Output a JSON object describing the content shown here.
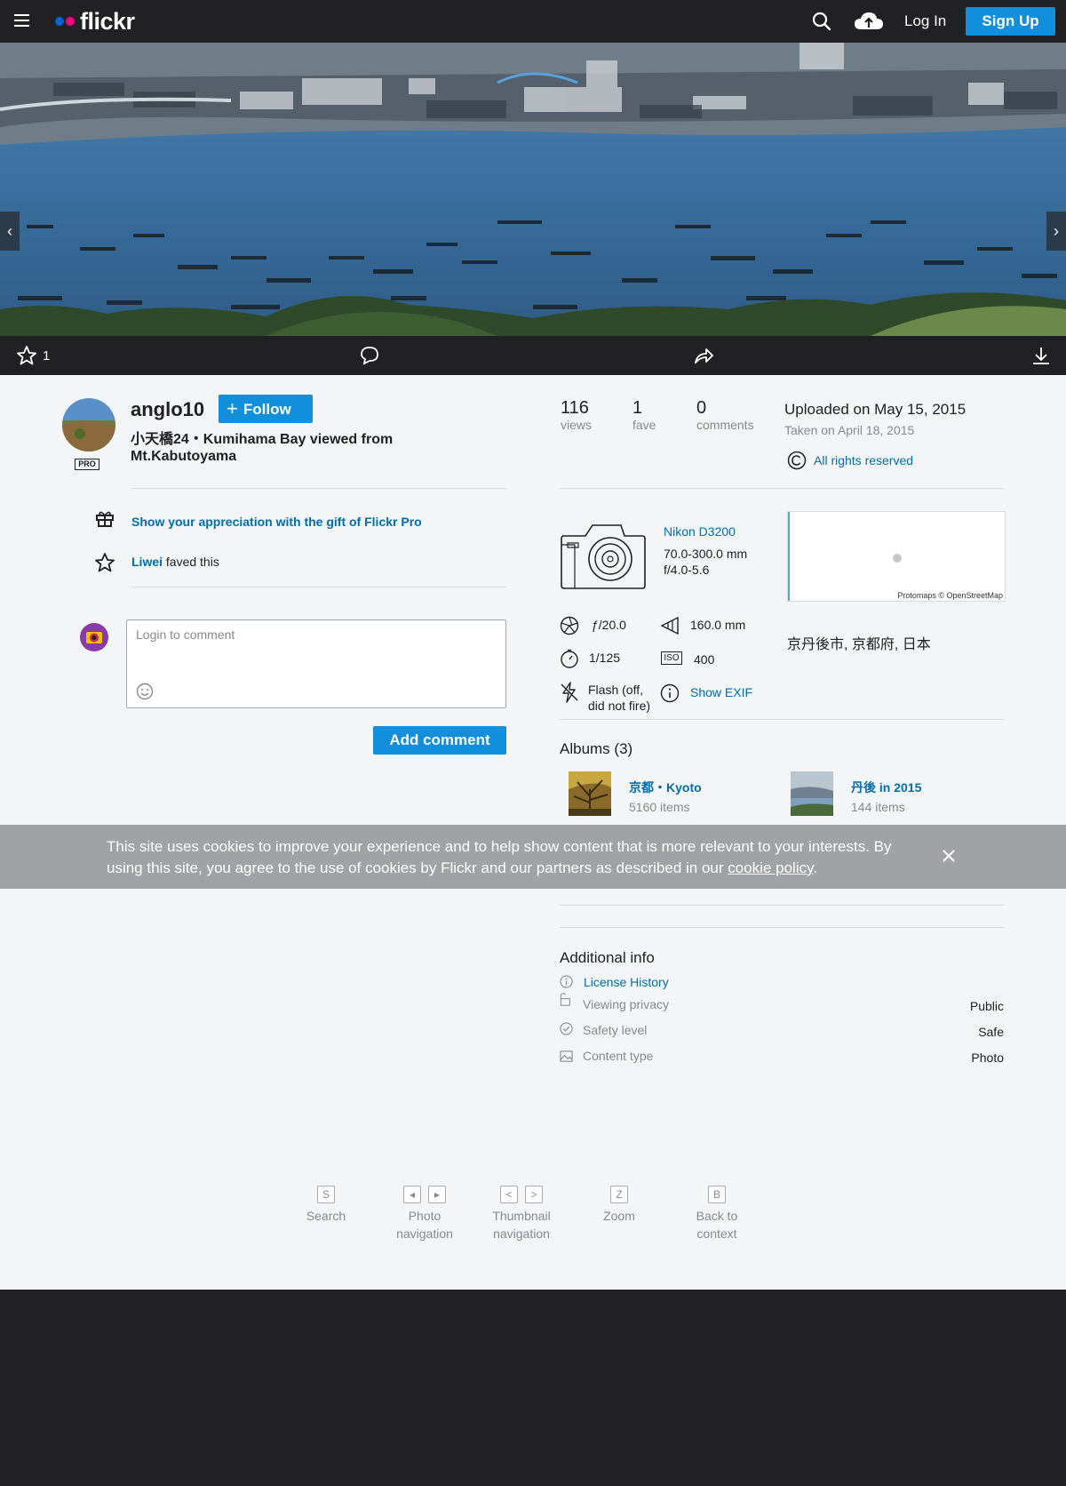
{
  "header": {
    "logo": "flickr",
    "login": "Log In",
    "signup": "Sign Up",
    "colors": {
      "blue_dot": "#0063dc",
      "pink_dot": "#ff0084",
      "accent": "#128fdc"
    }
  },
  "photo_nav": {
    "prev": "‹",
    "next": "›"
  },
  "action_bar": {
    "fave_count": "1"
  },
  "owner": {
    "username": "anglo10",
    "badge": "PRO",
    "follow_label": "Follow",
    "photo_title": "小天橋24・Kumihama Bay viewed from Mt.Kabutoyama"
  },
  "appreciation": {
    "gift_text": "Show your appreciation with the gift of Flickr Pro"
  },
  "faves": {
    "user": "Liwei",
    "text": "faved this"
  },
  "comment": {
    "placeholder": "Login to comment",
    "button": "Add comment"
  },
  "stats": {
    "views": "116",
    "views_label": "views",
    "faves": "1",
    "faves_label": "fave",
    "comments": "0",
    "comments_label": "comments"
  },
  "dates": {
    "uploaded": "Uploaded on May 15, 2015",
    "taken": "Taken on April 18, 2015",
    "rights": "All rights reserved"
  },
  "camera": {
    "model": "Nikon D3200",
    "lens": "70.0-300.0 mm",
    "aperture_range": "f/4.0-5.6"
  },
  "map": {
    "attribution": "Protomaps © OpenStreetMap"
  },
  "location": "京丹後市, 京都府, 日本",
  "exif": {
    "aperture": "ƒ/20.0",
    "focal_length": "160.0 mm",
    "shutter": "1/125",
    "iso": "400",
    "iso_label": "ISO",
    "flash_line1": "Flash (off,",
    "flash_line2": "did not fire)",
    "show_exif": "Show EXIF"
  },
  "albums": {
    "title": "Albums (3)",
    "items": [
      {
        "name": "京都・Kyoto",
        "count": "5160 items"
      },
      {
        "name": "丹後 in 2015",
        "count": "144 items"
      }
    ]
  },
  "cookie": {
    "text": "This site uses cookies to improve your experience and to help show content that is more relevant to your interests. By using this site, you agree to the use of cookies by Flickr and our partners as described in our ",
    "link": "cookie policy",
    "suffix": "."
  },
  "additional_info": {
    "title": "Additional info",
    "license_history": "License History",
    "rows": [
      {
        "label": "Viewing privacy",
        "value": "Public"
      },
      {
        "label": "Safety level",
        "value": "Safe"
      },
      {
        "label": "Content type",
        "value": "Photo"
      }
    ]
  },
  "shortcuts": [
    {
      "keys": [
        "S"
      ],
      "line1": "Search",
      "line2": ""
    },
    {
      "keys": [
        "◂",
        "▸"
      ],
      "line1": "Photo",
      "line2": "navigation"
    },
    {
      "keys": [
        "<",
        ">"
      ],
      "line1": "Thumbnail",
      "line2": "navigation"
    },
    {
      "keys": [
        "Z"
      ],
      "line1": "Zoom",
      "line2": ""
    },
    {
      "keys": [
        "B"
      ],
      "line1": "Back to",
      "line2": "context"
    }
  ]
}
